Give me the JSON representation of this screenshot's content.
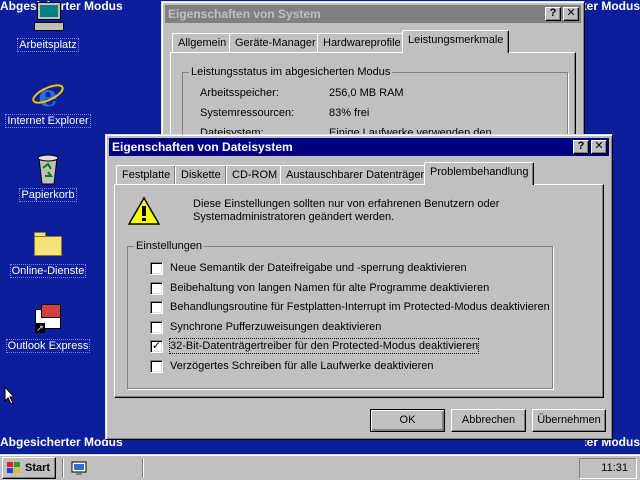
{
  "desktop": {
    "mode_label": "Abgesicherter Modus",
    "icons": [
      {
        "label": "Arbeitsplatz",
        "icon": "computer-icon"
      },
      {
        "label": "Internet Explorer",
        "icon": "internet-explorer-icon"
      },
      {
        "label": "Papierkorb",
        "icon": "recycle-bin-icon"
      },
      {
        "label": "Online-Dienste",
        "icon": "folder-icon"
      },
      {
        "label": "Outlook Express",
        "icon": "outlook-express-icon"
      }
    ]
  },
  "system_window": {
    "title": "Eigenschaften von System",
    "tabs": [
      "Allgemein",
      "Geräte-Manager",
      "Hardwareprofile",
      "Leistungsmerkmale"
    ],
    "active_tab": "Leistungsmerkmale",
    "group_label": "Leistungsstatus im abgesicherten Modus",
    "rows": [
      {
        "label": "Arbeitsspeicher:",
        "value": "256,0 MB RAM"
      },
      {
        "label": "Systemressourcen:",
        "value": "83% frei"
      },
      {
        "label": "Dateisystem:",
        "value": "Einige Laufwerke verwenden den"
      }
    ]
  },
  "fs_dialog": {
    "title": "Eigenschaften von Dateisystem",
    "tabs": [
      "Festplatte",
      "Diskette",
      "CD-ROM",
      "Austauschbarer Datenträger",
      "Problembehandlung"
    ],
    "active_tab": "Problembehandlung",
    "warning_line1": "Diese Einstellungen sollten nur von erfahrenen Benutzern oder",
    "warning_line2": "Systemadministratoren geändert werden.",
    "group_label": "Einstellungen",
    "options": [
      {
        "label": "Neue Semantik der Dateifreigabe und -sperrung deaktivieren",
        "checked": false
      },
      {
        "label": "Beibehaltung von langen Namen für alte Programme deaktivieren",
        "checked": false
      },
      {
        "label": "Behandlungsroutine für Festplatten-Interrupt im Protected-Modus deaktivieren",
        "checked": false
      },
      {
        "label": "Synchrone Pufferzuweisungen deaktivieren",
        "checked": false
      },
      {
        "label": "32-Bit-Datenträgertreiber für den Protected-Modus deaktivieren",
        "checked": true
      },
      {
        "label": "Verzögertes Schreiben für alle Laufwerke deaktivieren",
        "checked": false
      }
    ],
    "buttons": {
      "ok": "OK",
      "cancel": "Abbrechen",
      "apply": "Übernehmen"
    }
  },
  "taskbar": {
    "start_label": "Start",
    "clock": "11:31"
  },
  "colors": {
    "desktop": "#0b1f9c",
    "title_active": "#000080",
    "title_inactive": "#808080",
    "face": "#c0c0c0"
  }
}
